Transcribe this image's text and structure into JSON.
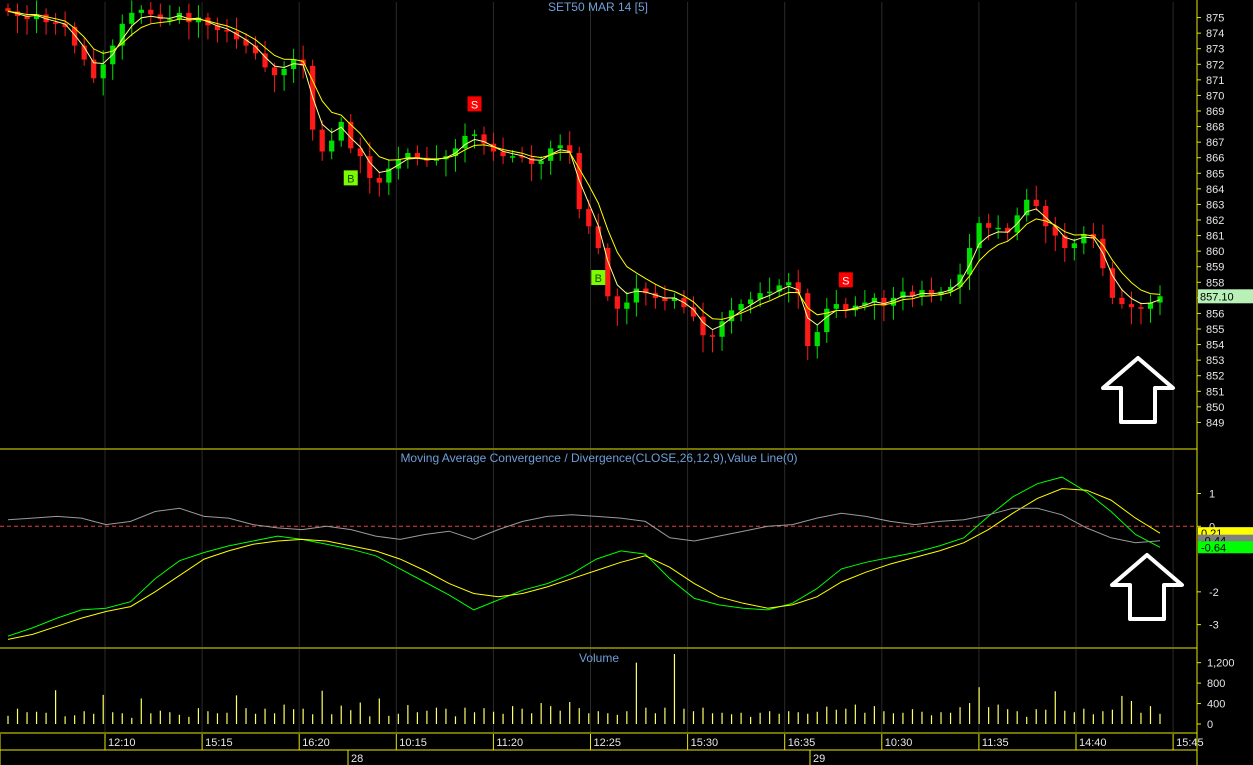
{
  "chart_data": [
    {
      "type": "candlestick",
      "title": "SET50 MAR 14   [5]",
      "ylim": [
        848,
        876
      ],
      "y_ticks": [
        849,
        850,
        851,
        852,
        853,
        854,
        855,
        856,
        857,
        858,
        859,
        860,
        861,
        862,
        863,
        864,
        865,
        866,
        867,
        868,
        869,
        870,
        871,
        872,
        873,
        874,
        875
      ],
      "last_price_label": "857.10",
      "close_values": [
        875.4,
        875.1,
        874.9,
        875.2,
        874.7,
        874.6,
        874.4,
        873.2,
        872.3,
        871.1,
        872.0,
        873.2,
        874.6,
        875.3,
        875.5,
        875.2,
        874.9,
        874.9,
        875.3,
        874.7,
        875.0,
        874.5,
        874.2,
        874.1,
        873.6,
        873.2,
        872.7,
        871.8,
        871.3,
        871.7,
        872.3,
        871.9,
        867.8,
        866.4,
        867.1,
        868.3,
        866.6,
        866.1,
        864.7,
        864.4,
        865.3,
        865.9,
        866.3,
        866.0,
        865.8,
        865.9,
        866.1,
        866.6,
        867.4,
        867.5,
        866.9,
        866.4,
        866.1,
        866.1,
        866.0,
        865.6,
        865.8,
        866.6,
        866.8,
        866.3,
        862.7,
        861.6,
        860.2,
        857.1,
        856.3,
        856.7,
        857.6,
        857.3,
        857.0,
        856.8,
        857.0,
        856.4,
        855.8,
        854.6,
        854.5,
        855.5,
        856.2,
        856.6,
        856.9,
        857.3,
        857.4,
        857.8,
        858.0,
        857.3,
        853.9,
        854.8,
        856.3,
        856.6,
        856.2,
        856.5,
        856.7,
        857.0,
        856.5,
        857.0,
        857.4,
        857.1,
        857.5,
        857.2,
        857.4,
        857.7,
        858.5,
        860.2,
        861.8,
        861.5,
        861.5,
        861.2,
        862.3,
        863.3,
        862.9,
        861.6,
        861.0,
        860.2,
        860.5,
        861.1,
        860.8,
        858.9,
        857.0,
        856.6,
        856.4,
        856.3,
        856.7,
        857.1
      ],
      "signals": [
        {
          "label": "B",
          "bar": 36,
          "kind": "buy"
        },
        {
          "label": "S",
          "bar": 49,
          "kind": "sell"
        },
        {
          "label": "B",
          "bar": 62,
          "kind": "buy"
        },
        {
          "label": "S",
          "bar": 88,
          "kind": "sell"
        }
      ]
    },
    {
      "type": "line",
      "title": "Moving Average Convergence / Divergence(CLOSE,26,12,9),Value Line(0)",
      "ylim": [
        -3.5,
        1.9
      ],
      "y_ticks": [
        -3,
        -2,
        0,
        1
      ],
      "reference_line": 0,
      "badges": [
        {
          "text": "0.21",
          "color": "#ffff00",
          "value": -0.21
        },
        {
          "text": "-0.44",
          "color": "#808080",
          "value": -0.44
        },
        {
          "text": "-0.64",
          "color": "#00ff00",
          "value": -0.64
        }
      ],
      "series": [
        {
          "color": "#00ff00",
          "values": [
            -3.35,
            -3.1,
            -2.8,
            -2.55,
            -2.5,
            -2.3,
            -1.6,
            -1.05,
            -0.8,
            -0.6,
            -0.45,
            -0.3,
            -0.4,
            -0.55,
            -0.7,
            -0.9,
            -1.3,
            -1.7,
            -2.1,
            -2.55,
            -2.25,
            -1.95,
            -1.75,
            -1.45,
            -1.0,
            -0.75,
            -0.85,
            -1.6,
            -2.2,
            -2.4,
            -2.5,
            -2.55,
            -2.35,
            -1.9,
            -1.3,
            -1.1,
            -0.95,
            -0.8,
            -0.6,
            -0.35,
            0.3,
            0.9,
            1.3,
            1.5,
            1.05,
            0.45,
            -0.25,
            -0.64
          ]
        },
        {
          "color": "#ffff00",
          "values": [
            -3.45,
            -3.3,
            -3.05,
            -2.8,
            -2.6,
            -2.45,
            -2.0,
            -1.5,
            -1.0,
            -0.75,
            -0.55,
            -0.45,
            -0.4,
            -0.45,
            -0.6,
            -0.75,
            -1.0,
            -1.35,
            -1.75,
            -2.05,
            -2.15,
            -2.05,
            -1.85,
            -1.6,
            -1.35,
            -1.1,
            -0.9,
            -1.25,
            -1.75,
            -2.15,
            -2.35,
            -2.5,
            -2.4,
            -2.15,
            -1.7,
            -1.4,
            -1.15,
            -0.95,
            -0.75,
            -0.5,
            -0.1,
            0.4,
            0.85,
            1.15,
            1.1,
            0.8,
            0.25,
            -0.21
          ]
        },
        {
          "color": "#9a9a9a",
          "values": [
            0.2,
            0.25,
            0.3,
            0.25,
            0.05,
            0.15,
            0.45,
            0.55,
            0.3,
            0.25,
            0.05,
            -0.05,
            -0.1,
            0.0,
            -0.1,
            -0.3,
            -0.4,
            -0.25,
            -0.15,
            -0.4,
            -0.1,
            0.15,
            0.3,
            0.35,
            0.3,
            0.25,
            0.15,
            -0.35,
            -0.45,
            -0.3,
            -0.15,
            0.0,
            0.05,
            0.25,
            0.4,
            0.3,
            0.15,
            0.05,
            0.15,
            0.2,
            0.35,
            0.55,
            0.55,
            0.35,
            -0.05,
            -0.35,
            -0.5,
            -0.44
          ]
        }
      ]
    },
    {
      "type": "bar",
      "title": "Volume",
      "ylim": [
        0,
        1350
      ],
      "y_ticks": [
        0,
        400,
        800,
        1200
      ],
      "y_tick_labels": [
        "0",
        "400",
        "800",
        "1,200"
      ],
      "color": "#ffff66",
      "values": [
        160,
        300,
        230,
        240,
        220,
        660,
        150,
        170,
        250,
        200,
        570,
        230,
        210,
        120,
        500,
        210,
        260,
        230,
        180,
        140,
        310,
        250,
        210,
        220,
        560,
        310,
        200,
        300,
        210,
        380,
        290,
        300,
        190,
        650,
        190,
        360,
        270,
        420,
        150,
        500,
        160,
        200,
        370,
        230,
        260,
        320,
        300,
        150,
        320,
        230,
        310,
        240,
        200,
        350,
        300,
        210,
        410,
        350,
        260,
        430,
        310,
        210,
        250,
        210,
        180,
        250,
        1200,
        320,
        210,
        320,
        1370,
        300,
        250,
        320,
        210,
        220,
        190,
        220,
        140,
        220,
        250,
        200,
        250,
        230,
        200,
        240,
        340,
        280,
        300,
        380,
        220,
        350,
        250,
        210,
        220,
        290,
        240,
        170,
        230,
        220,
        330,
        410,
        720,
        330,
        380,
        290,
        250,
        140,
        290,
        280,
        640,
        260,
        230,
        300,
        190,
        250,
        280,
        550,
        450,
        220,
        350,
        200
      ]
    }
  ],
  "x_axis": {
    "time_labels": [
      "12:10",
      "15:15",
      "16:20",
      "10:15",
      "11:20",
      "12:25",
      "15:30",
      "16:35",
      "10:30",
      "11:35",
      "14:40",
      "15:45"
    ],
    "date_labels": [
      "28",
      "29"
    ]
  },
  "colors": {
    "background": "#000000",
    "frame": "#e8e800",
    "grid": "#2a2a2a",
    "up_candle": "#00e000",
    "down_candle": "#ff1a1a",
    "ma_fast": "#ffff88",
    "ma_slow": "#ffff00",
    "buy_signal": "#7cfc00",
    "sell_signal": "#ff0000",
    "price_badge": "#b8f0b8",
    "title_text": "#6f9fd8",
    "arrow": "#ffffff"
  },
  "annotations": [
    "up-arrow",
    "up-arrow"
  ]
}
